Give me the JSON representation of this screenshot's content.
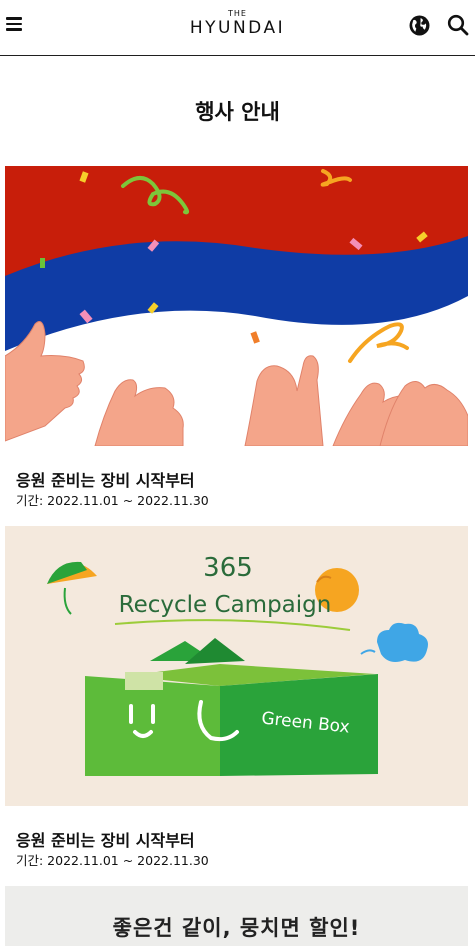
{
  "header": {
    "logo_small": "THE",
    "logo_main": "HYUNDAI",
    "icons": [
      "menu-icon",
      "globe-icon",
      "search-icon"
    ]
  },
  "page": {
    "title": "행사 안내"
  },
  "events": [
    {
      "title": "응원 준비는 장비 시작부터",
      "period": "기간: 2022.11.01 ~ 2022.11.30"
    },
    {
      "title": "응원 준비는 장비 시작부터",
      "period": "기간: 2022.11.01 ~ 2022.11.30",
      "image_text": {
        "number": "365",
        "campaign": "Recycle Campaign",
        "box": "Green Box"
      }
    }
  ],
  "banner3": {
    "text": "좋은건 같이, 뭉치면 할인!"
  },
  "colors": {
    "banner1_red": "#c81e0a",
    "banner1_blue": "#0f3ca5",
    "banner2_bg": "#f4e9dd",
    "green_box": "#2aa33a",
    "text_green": "#2a6b3a"
  }
}
